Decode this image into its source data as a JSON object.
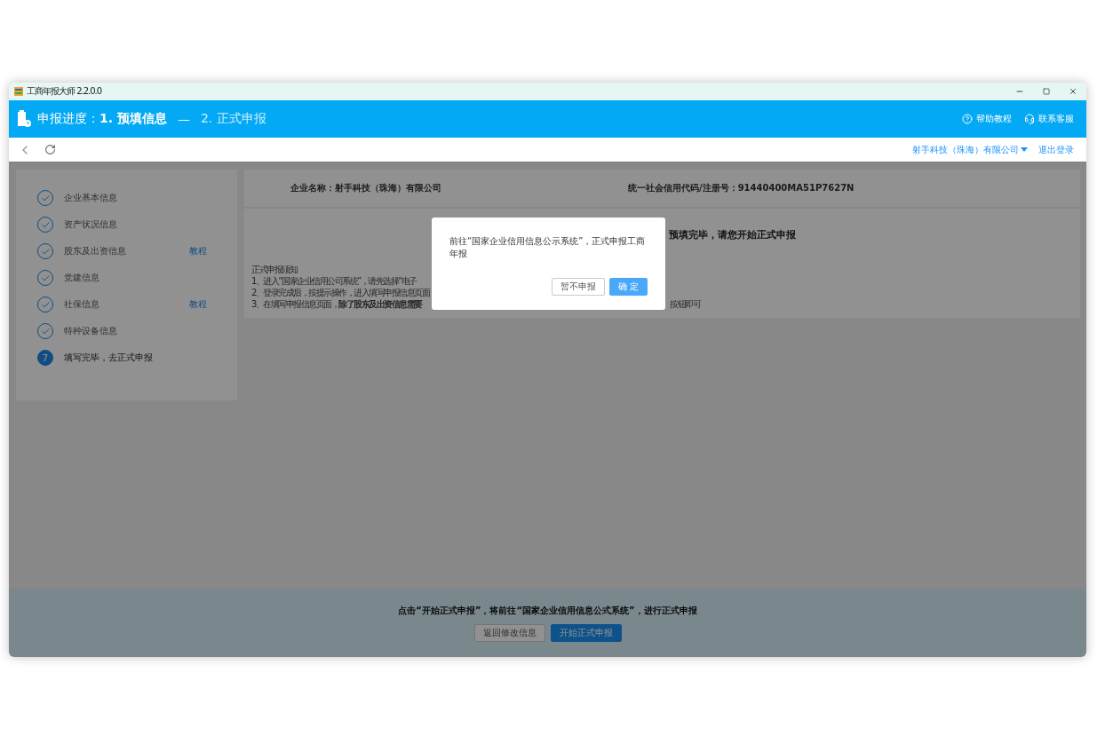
{
  "window": {
    "title": "工商年报大师 2.2.0.0"
  },
  "header": {
    "label": "申报进度：",
    "steps": [
      {
        "label": "1. 预填信息",
        "selected": true
      },
      {
        "label": "2. 正式申报",
        "selected": false
      }
    ],
    "separator": "—",
    "links": [
      {
        "kind": "help",
        "label": "帮助教程"
      },
      {
        "kind": "service",
        "label": "联系客服"
      }
    ]
  },
  "nav": {
    "account": "射手科技（珠海）有限公司",
    "logout": "退出登录"
  },
  "sidebar": {
    "steps": [
      {
        "label": "企业基本信息",
        "completed": true
      },
      {
        "label": "资产状况信息",
        "completed": true
      },
      {
        "label": "股东及出资信息",
        "completed": true,
        "link": "教程"
      },
      {
        "label": "党建信息",
        "completed": true
      },
      {
        "label": "社保信息",
        "completed": true,
        "link": "教程"
      },
      {
        "label": "特种设备信息",
        "completed": true
      },
      {
        "label": "填写完毕，去正式申报",
        "completed": false,
        "number": "7"
      }
    ]
  },
  "company": {
    "name": "企业名称：射手科技（珠海）有限公司",
    "code": "统一社会信用代码/注册号：91440400MA51P7627N"
  },
  "notice": {
    "heading": "预填完毕，请您开始正式申报",
    "title": "正式申报须知",
    "lines": [
      "1、进入“国家企业信用公司系统”，请先选择“电子",
      "2、登录完成后，按提示操作，进入填写申报信息页面",
      "3、在填写申报信息页面，**除了股东及出资信息需要**"
    ],
    "tail": "按钮即可"
  },
  "footer": {
    "message": "点击“开始正式申报”，将前往“国家企业信用信息公式系统”，进行正式申报",
    "buttons": [
      {
        "label": "返回修改信息",
        "kind": "secondary"
      },
      {
        "label": "开始正式申报",
        "kind": "primary"
      }
    ]
  },
  "dialog": {
    "message": "前往“国家企业信用信息公示系统”，正式申报工商年报",
    "buttons": [
      {
        "label": "暂不申报",
        "kind": "secondary"
      },
      {
        "label": "确 定",
        "kind": "primary"
      }
    ]
  }
}
